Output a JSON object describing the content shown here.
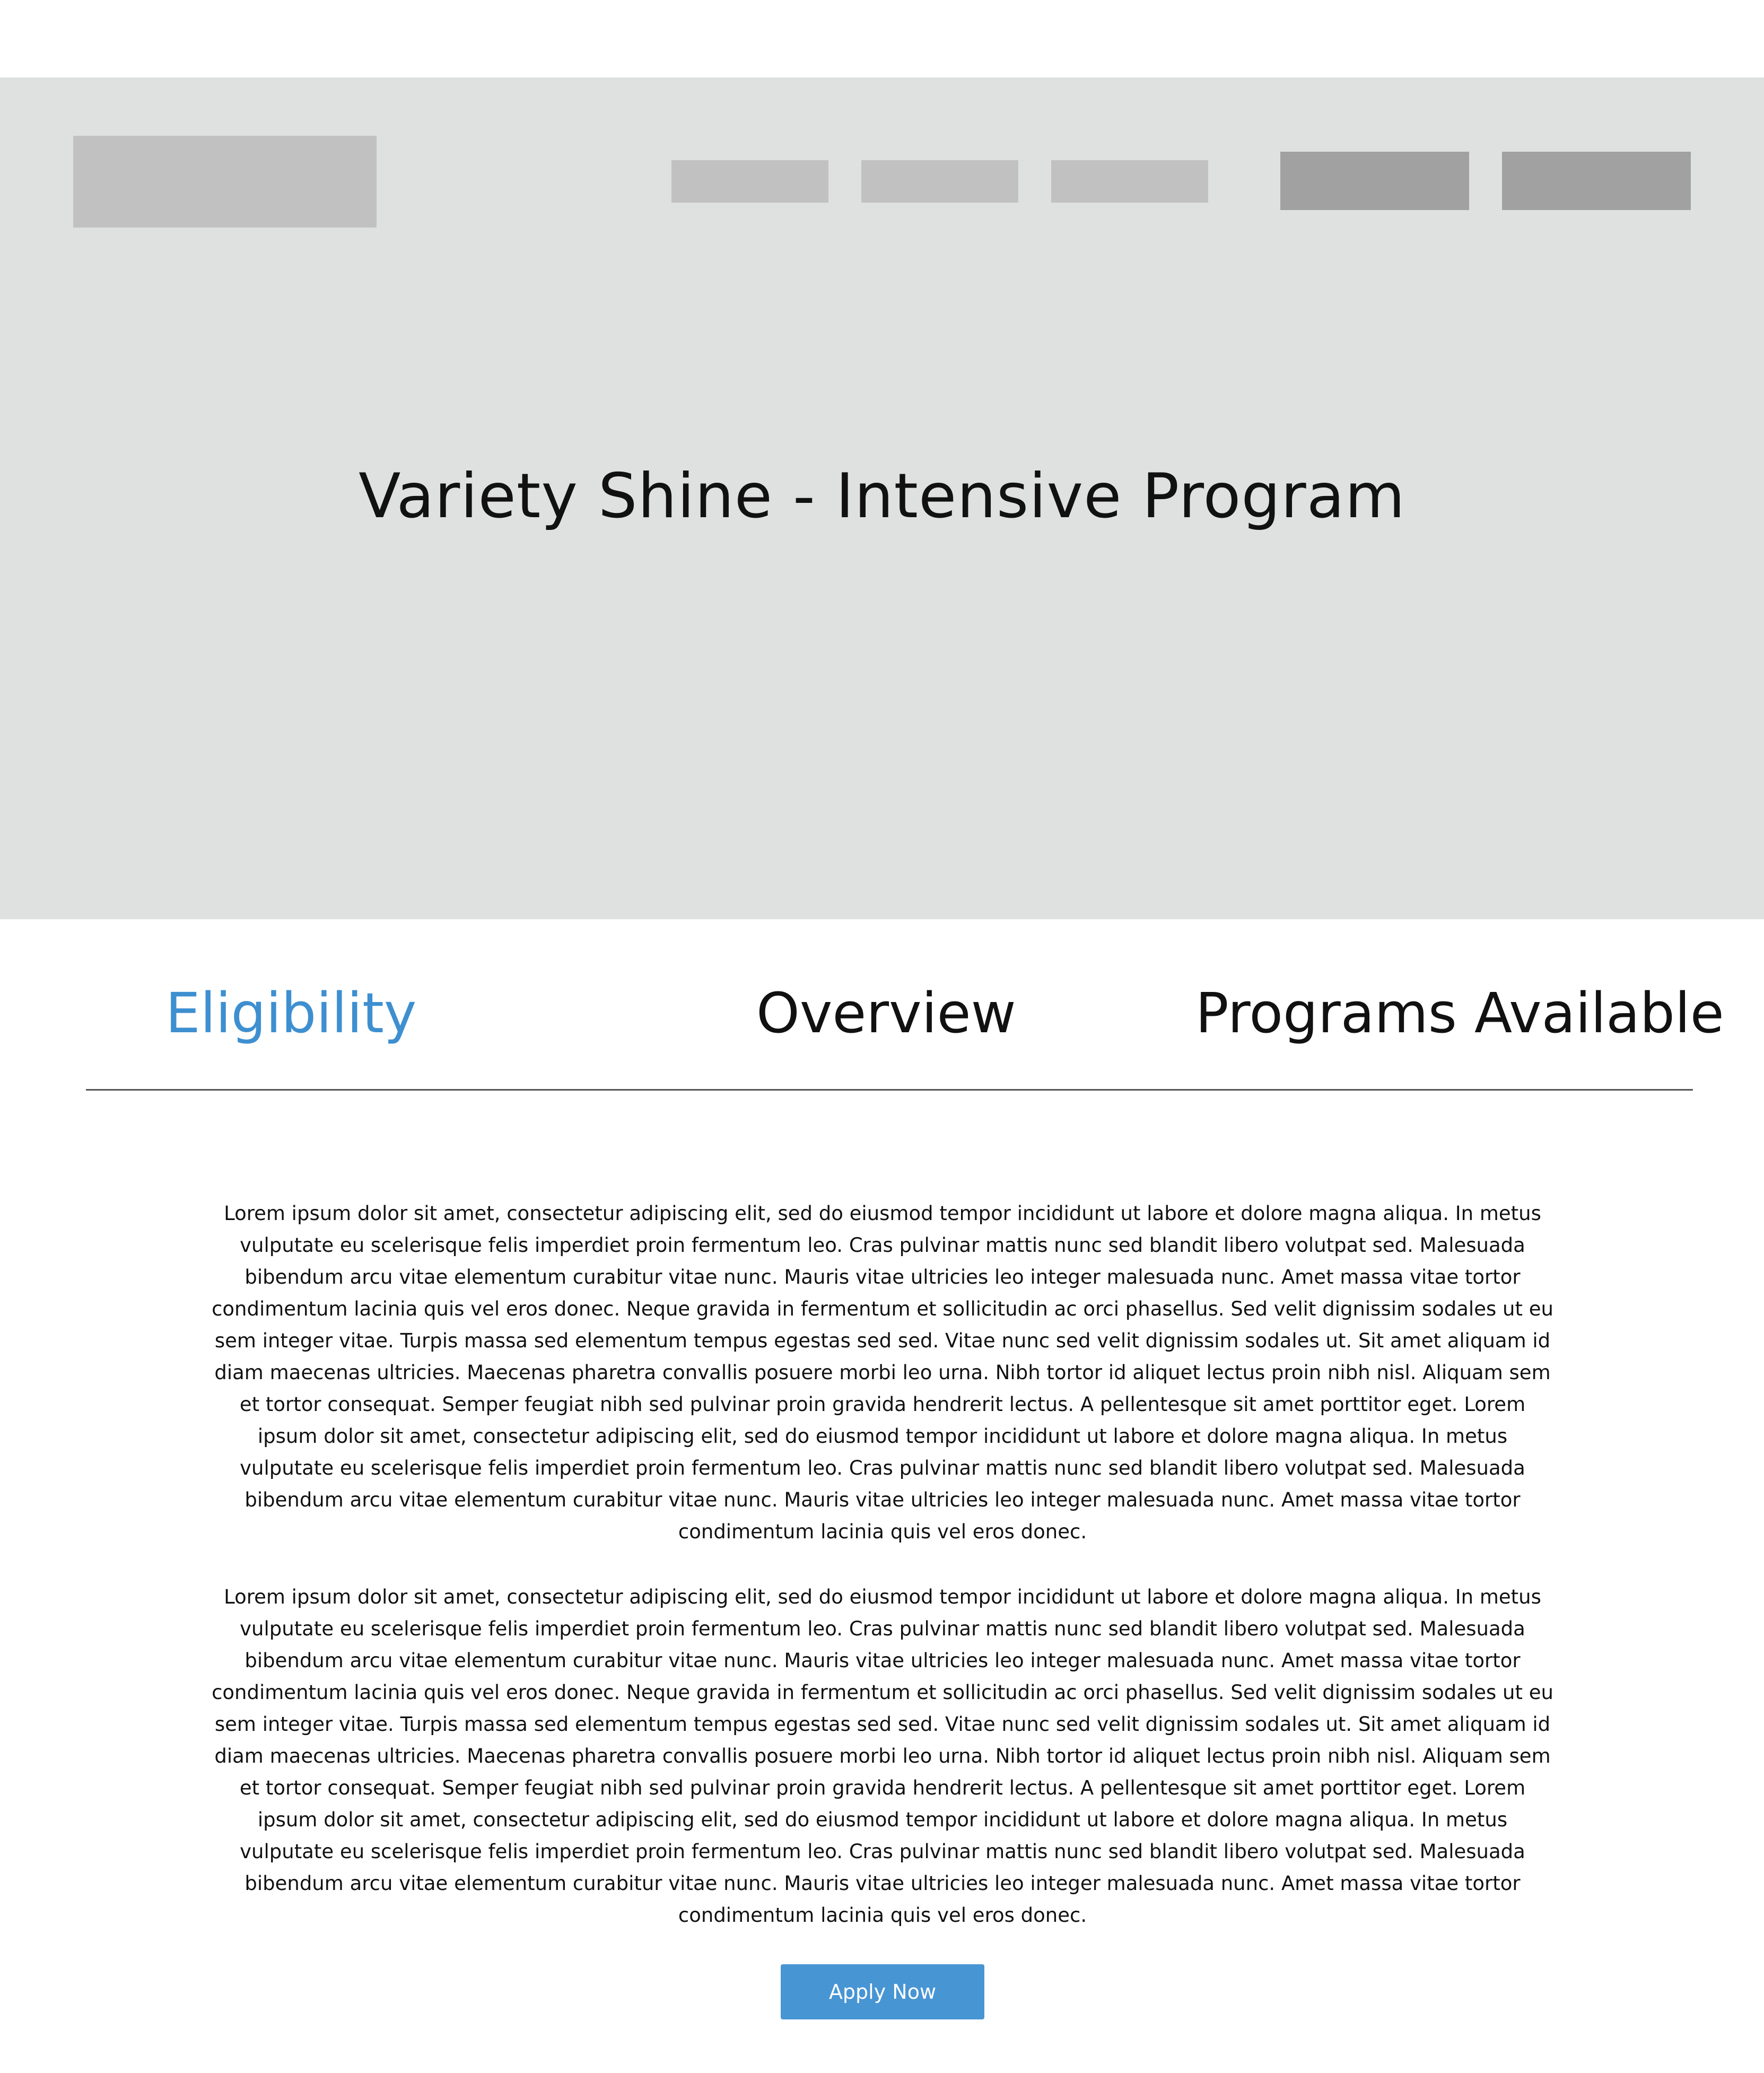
{
  "hero": {
    "title": "Variety Shine - Intensive Program"
  },
  "tabs": [
    {
      "label": "Eligibility",
      "active": true
    },
    {
      "label": "Overview",
      "active": false
    },
    {
      "label": "Programs Available",
      "active": false
    }
  ],
  "content": {
    "paragraphs": [
      "Lorem ipsum dolor sit amet, consectetur adipiscing elit, sed do eiusmod tempor incididunt ut labore et dolore magna aliqua. In metus vulputate eu scelerisque felis imperdiet proin fermentum leo. Cras pulvinar mattis nunc sed blandit libero volutpat sed. Malesuada bibendum arcu vitae elementum curabitur vitae nunc. Mauris vitae ultricies leo integer malesuada nunc. Amet massa vitae tortor condimentum lacinia quis vel eros donec. Neque gravida in fermentum et sollicitudin ac orci phasellus. Sed velit dignissim sodales ut eu sem integer vitae. Turpis massa sed elementum tempus egestas sed sed. Vitae nunc sed velit dignissim sodales ut. Sit amet aliquam id diam maecenas ultricies. Maecenas pharetra convallis posuere morbi leo urna. Nibh tortor id aliquet lectus proin nibh nisl. Aliquam sem et tortor consequat. Semper feugiat nibh sed pulvinar proin gravida hendrerit lectus. A pellentesque sit amet porttitor eget. Lorem ipsum dolor sit amet, consectetur adipiscing elit, sed do eiusmod tempor incididunt ut labore et dolore magna aliqua. In metus vulputate eu scelerisque felis imperdiet proin fermentum leo. Cras pulvinar mattis nunc sed blandit libero volutpat sed. Malesuada bibendum arcu vitae elementum curabitur vitae nunc. Mauris vitae ultricies leo integer malesuada nunc. Amet massa vitae tortor condimentum lacinia quis vel eros donec.",
      "Lorem ipsum dolor sit amet, consectetur adipiscing elit, sed do eiusmod tempor incididunt ut labore et dolore magna aliqua. In metus vulputate eu scelerisque felis imperdiet proin fermentum leo. Cras pulvinar mattis nunc sed blandit libero volutpat sed. Malesuada bibendum arcu vitae elementum curabitur vitae nunc. Mauris vitae ultricies leo integer malesuada nunc. Amet massa vitae tortor condimentum lacinia quis vel eros donec. Neque gravida in fermentum et sollicitudin ac orci phasellus. Sed velit dignissim sodales ut eu sem integer vitae. Turpis massa sed elementum tempus egestas sed sed. Vitae nunc sed velit dignissim sodales ut. Sit amet aliquam id diam maecenas ultricies. Maecenas pharetra convallis posuere morbi leo urna. Nibh tortor id aliquet lectus proin nibh nisl. Aliquam sem et tortor consequat. Semper feugiat nibh sed pulvinar proin gravida hendrerit lectus. A pellentesque sit amet porttitor eget. Lorem ipsum dolor sit amet, consectetur adipiscing elit, sed do eiusmod tempor incididunt ut labore et dolore magna aliqua. In metus vulputate eu scelerisque felis imperdiet proin fermentum leo. Cras pulvinar mattis nunc sed blandit libero volutpat sed. Malesuada bibendum arcu vitae elementum curabitur vitae nunc. Mauris vitae ultricies leo integer malesuada nunc. Amet massa vitae tortor condimentum lacinia quis vel eros donec."
    ]
  },
  "apply_button": {
    "label": "Apply Now"
  },
  "colors": {
    "hero_background": "#dfe0e0",
    "placeholder_light": "#c1c1c1",
    "placeholder_dark": "#a1a1a1",
    "active_tab": "#3e8fd0",
    "button_background": "#4895d4",
    "text": "#111111"
  }
}
